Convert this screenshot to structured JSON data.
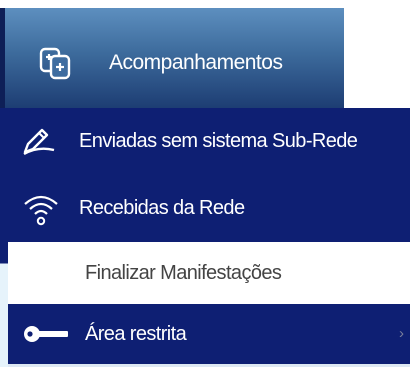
{
  "header": {
    "icon": "documents-icon",
    "label": "Acompanhamentos"
  },
  "menu": {
    "items": [
      {
        "label": "Enviadas sem sistema Sub-Rede",
        "icon": "pen-icon"
      },
      {
        "label": "Recebidas da Rede",
        "icon": "wifi-icon"
      },
      {
        "label": "Finalizar Manifestações",
        "icon": ""
      },
      {
        "label": "Área restrita",
        "icon": "key-icon",
        "chevron": "›"
      }
    ]
  },
  "colors": {
    "menu_dark_bg": "#0e1f73",
    "header_gradient_top": "#5d8fbf",
    "header_gradient_bottom": "#1d3d73",
    "text_light": "#ffffff",
    "text_dark": "#444444"
  }
}
